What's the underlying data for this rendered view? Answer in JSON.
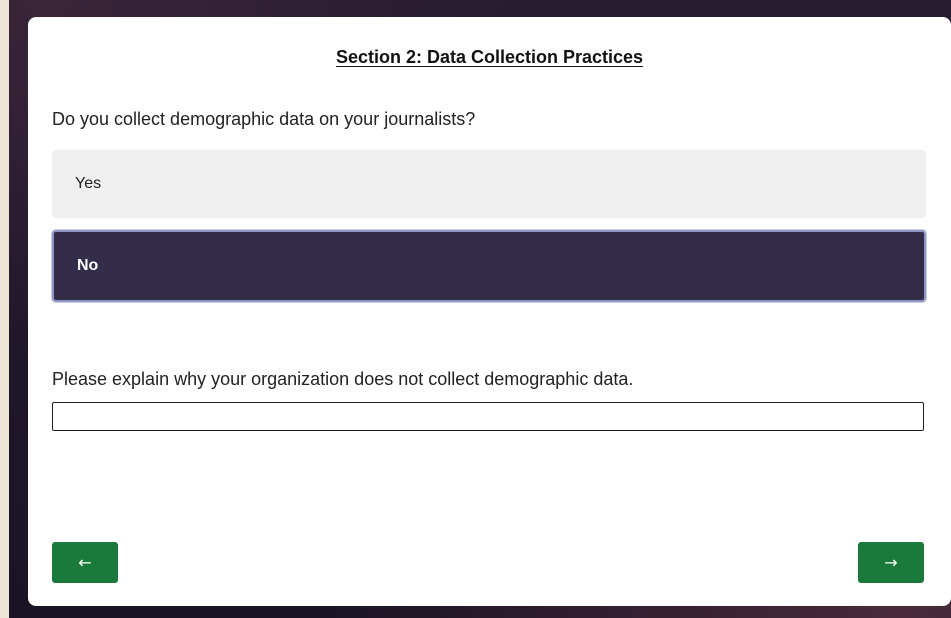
{
  "section": {
    "title": "Section 2: Data Collection Practices"
  },
  "question": {
    "text": "Do you collect demographic data on your journalists?",
    "options": [
      {
        "label": "Yes",
        "selected": false
      },
      {
        "label": "No",
        "selected": true
      }
    ]
  },
  "followup": {
    "label": "Please explain why your organization does not collect demographic data.",
    "value": "",
    "placeholder": ""
  },
  "navigation": {
    "back_icon": "left-arrow-icon",
    "back_glyph": "←",
    "next_icon": "right-arrow-icon",
    "next_glyph": "→"
  },
  "colors": {
    "selected_option": "#332d4a",
    "unselected_option": "#efefef",
    "nav_button": "#1a7a3c",
    "accent_border": "#8f96c2"
  }
}
